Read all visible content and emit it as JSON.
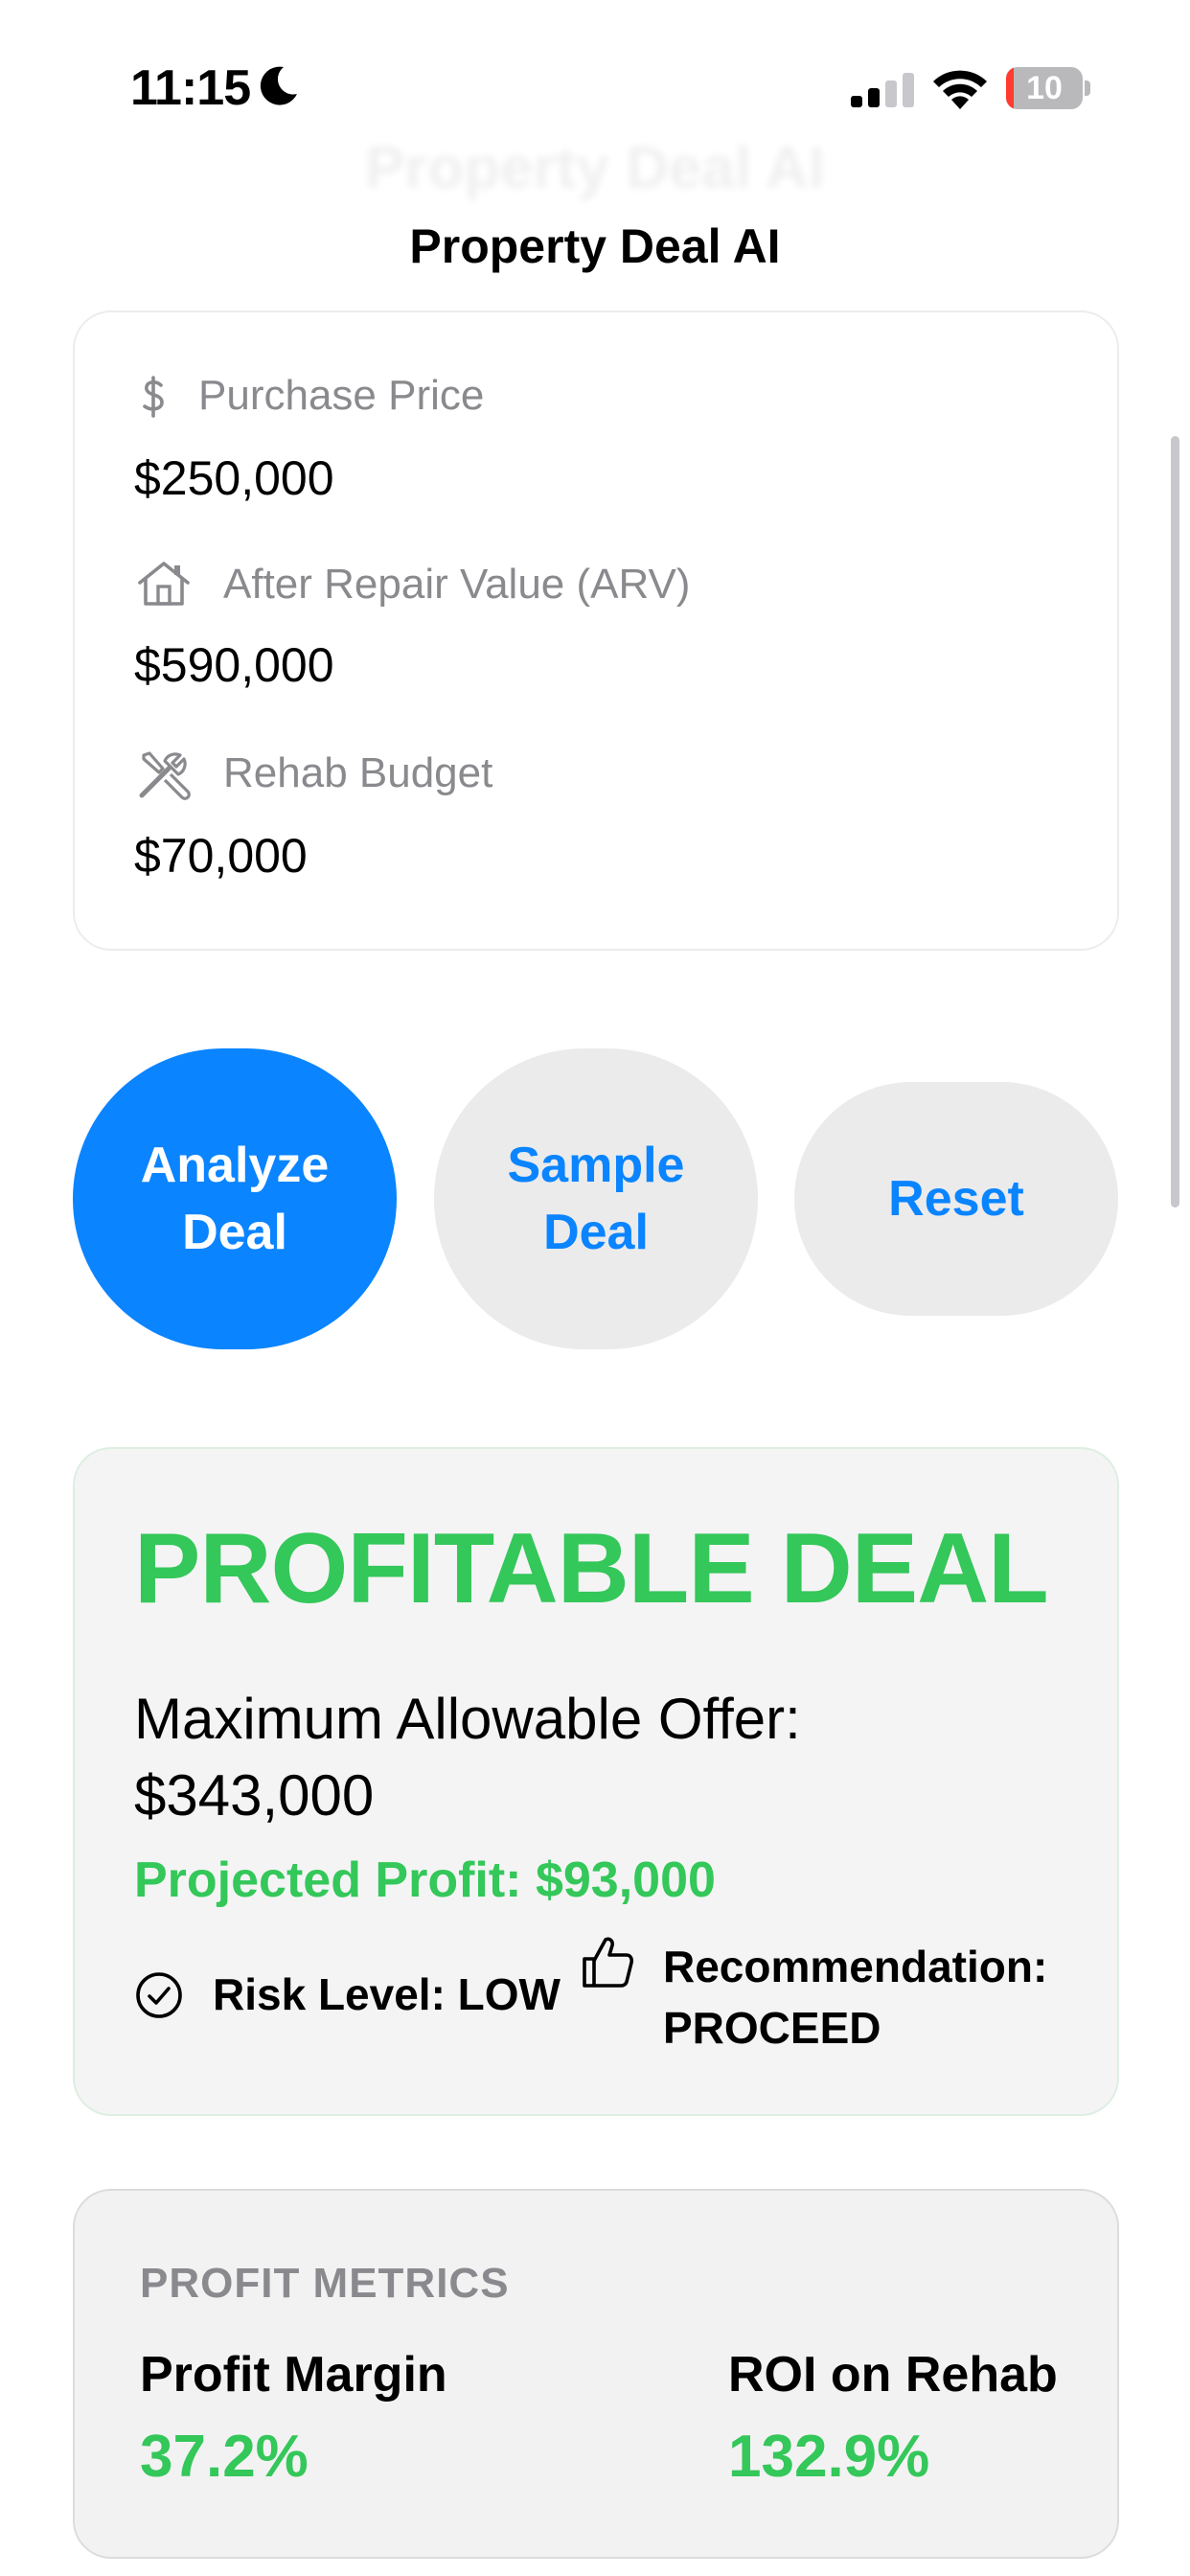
{
  "status_bar": {
    "time": "11:15",
    "battery_level": "10",
    "icons": [
      "moon-icon",
      "cellular-signal-icon",
      "wifi-icon",
      "battery-icon"
    ]
  },
  "nav": {
    "title": "Property Deal AI"
  },
  "inputs": [
    {
      "icon": "dollar-sign-icon",
      "label": "Purchase Price",
      "value": "$250,000"
    },
    {
      "icon": "house-icon",
      "label": "After Repair Value (ARV)",
      "value": "$590,000"
    },
    {
      "icon": "tools-icon",
      "label": "Rehab Budget",
      "value": "$70,000"
    }
  ],
  "buttons": {
    "analyze": "Analyze\nDeal",
    "sample": "Sample\nDeal",
    "reset": "Reset"
  },
  "result": {
    "verdict": "PROFITABLE DEAL",
    "mao_label": "Maximum Allowable Offer:",
    "mao_value": "$343,000",
    "projected_profit": "Projected Profit: $93,000",
    "risk": "Risk Level: LOW",
    "recommendation_label": "Recommendation:",
    "recommendation_value": "PROCEED"
  },
  "metrics": {
    "title": "PROFIT METRICS",
    "items": [
      {
        "label": "Profit Margin",
        "value": "37.2%"
      },
      {
        "label": "ROI on Rehab",
        "value": "132.9%"
      }
    ]
  },
  "colors": {
    "accent_blue": "#0a84ff",
    "success_green": "#34c759",
    "secondary_text": "#8a8a8e"
  }
}
